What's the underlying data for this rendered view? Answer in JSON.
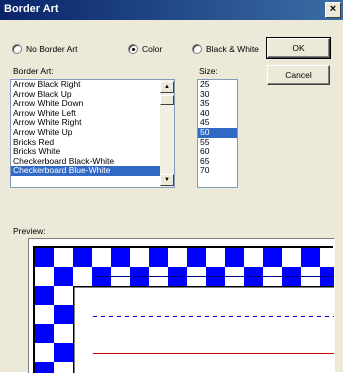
{
  "window": {
    "title": "Border Art",
    "close_glyph": "×"
  },
  "options": [
    {
      "label": "No Border Art",
      "checked": false
    },
    {
      "label": "Color",
      "checked": true
    },
    {
      "label": "Black & White",
      "checked": false
    }
  ],
  "buttons": {
    "ok": "OK",
    "cancel": "Cancel"
  },
  "border_art": {
    "label": "Border Art:",
    "items": [
      "Arrow Black Right",
      "Arrow Black Up",
      "Arrow White Down",
      "Arrow White Left",
      "Arrow White Right",
      "Arrow White Up",
      "Bricks Red",
      "Bricks White",
      "Checkerboard Black-White",
      "Checkerboard Blue-White"
    ],
    "selected": "Checkerboard Blue-White"
  },
  "size": {
    "label": "Size:",
    "items": [
      "25",
      "30",
      "35",
      "40",
      "45",
      "50",
      "55",
      "60",
      "65",
      "70"
    ],
    "selected": "50"
  },
  "preview": {
    "label": "Preview:"
  },
  "colors": {
    "checker": "#0000ff",
    "line_top": "#00008b",
    "line_mid": "#0000cc",
    "line_bottom": "#cc0000"
  }
}
